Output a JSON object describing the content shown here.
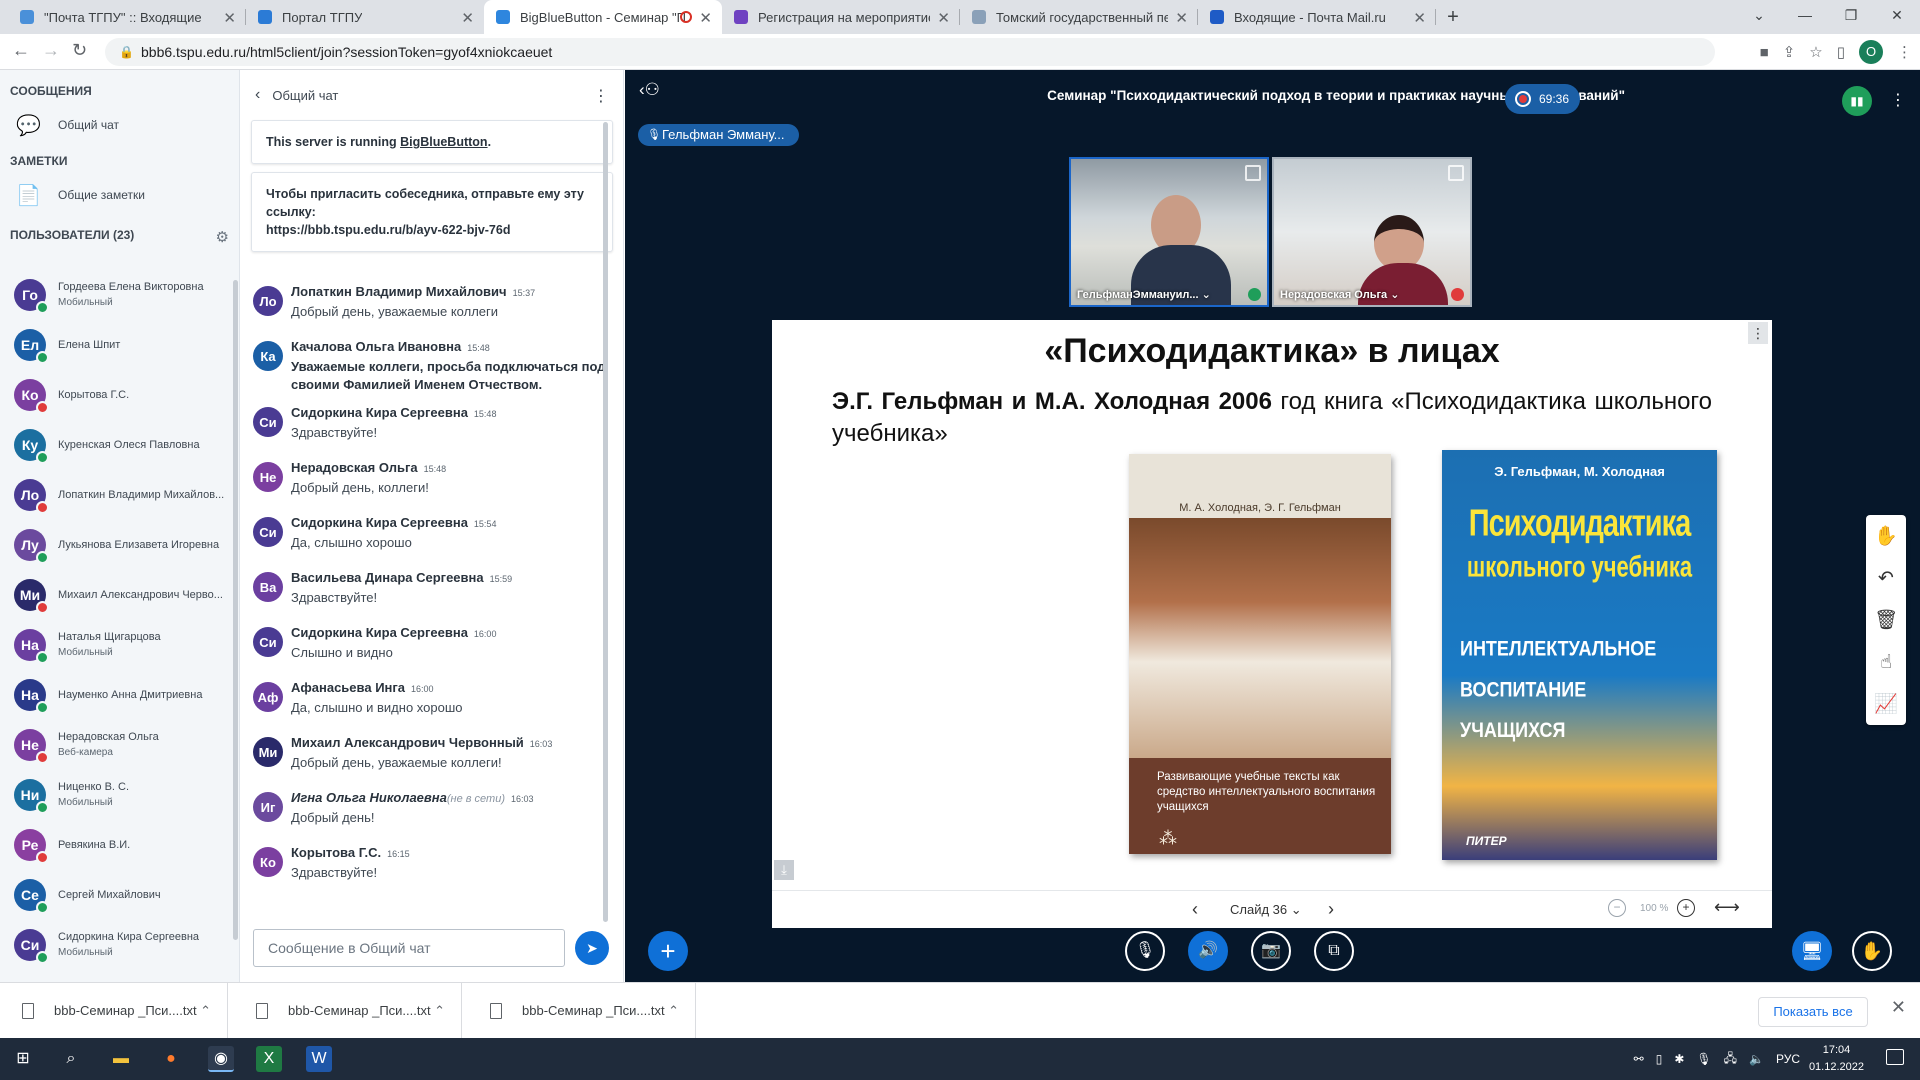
{
  "browser": {
    "tabs": [
      {
        "label": "\"Почта ТГПУ\" :: Входящие",
        "color": "#4a90d9"
      },
      {
        "label": "Портал ТГПУ",
        "color": "#2b7bd6"
      },
      {
        "label": "BigBlueButton - Семинар \"П",
        "color": "#2e86de"
      },
      {
        "label": "Регистрация на мероприятие -",
        "color": "#6f42c1"
      },
      {
        "label": "Томский государственный педа",
        "color": "#8aa0b8"
      },
      {
        "label": "Входящие - Почта Mail.ru",
        "color": "#1e5bc6"
      }
    ],
    "url": "bbb6.tspu.edu.ru/html5client/join?sessionToken=gyof4xniokcaeuet",
    "profile_letter": "O"
  },
  "sidebar": {
    "messages_head": "СООБЩЕНИЯ",
    "public_chat": "Общий чат",
    "notes_head": "ЗАМЕТКИ",
    "shared_notes": "Общие заметки",
    "users_head": "ПОЛЬЗОВАТЕЛИ (23)",
    "users": [
      {
        "initials": "Го",
        "name": "Гордеева Елена Викторовна",
        "sub": "Мобильный",
        "color": "#4a3b93",
        "status": "#1f9e5a"
      },
      {
        "initials": "Ел",
        "name": "Елена Шпит",
        "sub": "",
        "color": "#1b5fa6",
        "status": "#1f9e5a"
      },
      {
        "initials": "Ко",
        "name": "Корытова Г.С.",
        "sub": "",
        "color": "#7b3fa0",
        "status": "#e03b3b"
      },
      {
        "initials": "Ку",
        "name": "Куренская Олеся Павловна",
        "sub": "",
        "color": "#1b6fa0",
        "status": "#1f9e5a"
      },
      {
        "initials": "Ло",
        "name": "Лопаткин Владимир Михайлов...",
        "sub": "",
        "color": "#4a3b93",
        "status": "#e03b3b"
      },
      {
        "initials": "Лу",
        "name": "Лукьянова Елизавета Игоревна",
        "sub": "",
        "color": "#6b4a9e",
        "status": "#1f9e5a"
      },
      {
        "initials": "Ми",
        "name": "Михаил Александрович Черво...",
        "sub": "",
        "color": "#2a2a6a",
        "status": "#e03b3b"
      },
      {
        "initials": "На",
        "name": "Наталья Щигарцова",
        "sub": "Мобильный",
        "color": "#6b3fa0",
        "status": "#1f9e5a"
      },
      {
        "initials": "На",
        "name": "Науменко Анна Дмитриевна",
        "sub": "",
        "color": "#2a3a8a",
        "status": "#1f9e5a"
      },
      {
        "initials": "Не",
        "name": "Нерадовская Ольга",
        "sub": "Веб-камера",
        "color": "#7b3fa0",
        "status": "#e03b3b"
      },
      {
        "initials": "Ни",
        "name": "Ниценко В. С.",
        "sub": "Мобильный",
        "color": "#1b6fa0",
        "status": "#1f9e5a"
      },
      {
        "initials": "Ре",
        "name": "Ревякина В.И.",
        "sub": "",
        "color": "#8a3fa0",
        "status": "#e03b3b"
      },
      {
        "initials": "Се",
        "name": "Сергей Михайлович",
        "sub": "",
        "color": "#1b5fa6",
        "status": "#1f9e5a"
      },
      {
        "initials": "Си",
        "name": "Сидоркина Кира Сергеевна",
        "sub": "Мобильный",
        "color": "#4a3b93",
        "status": "#1f9e5a"
      }
    ]
  },
  "chat": {
    "title": "Общий чат",
    "server_notice_prefix": "This server is running",
    "server_notice_link": "BigBlueButton",
    "invite_text": "Чтобы пригласить собеседника, отправьте ему эту ссылку:",
    "invite_link": "https://bbb.tspu.edu.ru/b/ayv-622-bjv-76d",
    "messages": [
      {
        "initials": "Ло",
        "color": "#4a3b93",
        "name": "Лопаткин Владимир Михайлович",
        "time": "15:37",
        "text": "Добрый день, уважаемые коллеги",
        "bold": false,
        "offline": ""
      },
      {
        "initials": "Ка",
        "color": "#1b5fa6",
        "name": "Качалова Ольга Ивановна",
        "time": "15:48",
        "text": "Уважаемые коллеги, просьба подключаться под своими Фамилией Именем Отчеством.",
        "bold": true,
        "offline": ""
      },
      {
        "initials": "Си",
        "color": "#4a3b93",
        "name": "Сидоркина Кира Сергеевна",
        "time": "15:48",
        "text": "Здравствуйте!",
        "bold": false,
        "offline": ""
      },
      {
        "initials": "Не",
        "color": "#7b3fa0",
        "name": "Нерадовская Ольга",
        "time": "15:48",
        "text": "Добрый день, коллеги!",
        "bold": false,
        "offline": ""
      },
      {
        "initials": "Си",
        "color": "#4a3b93",
        "name": "Сидоркина Кира Сергеевна",
        "time": "15:54",
        "text": "Да, слышно хорошо",
        "bold": false,
        "offline": ""
      },
      {
        "initials": "Ва",
        "color": "#6b3fa0",
        "name": "Васильева Динара Сергеевна",
        "time": "15:59",
        "text": "Здравствуйте!",
        "bold": false,
        "offline": ""
      },
      {
        "initials": "Си",
        "color": "#4a3b93",
        "name": "Сидоркина Кира Сергеевна",
        "time": "16:00",
        "text": "Слышно и видно",
        "bold": false,
        "offline": ""
      },
      {
        "initials": "Аф",
        "color": "#6b3fa0",
        "name": "Афанасьева Инга",
        "time": "16:00",
        "text": "Да, слышно и видно хорошо",
        "bold": false,
        "offline": ""
      },
      {
        "initials": "Ми",
        "color": "#2a2a6a",
        "name": "Михаил Александрович Червонный",
        "time": "16:03",
        "text": "Добрый день, уважаемые коллеги!",
        "bold": false,
        "offline": ""
      },
      {
        "initials": "Иг",
        "color": "#6b4a9e",
        "name": "Игна Ольга Николаевна",
        "time": "16:03",
        "text": "Добрый день!",
        "bold": false,
        "offline": "(не в сети)"
      },
      {
        "initials": "Ко",
        "color": "#7b3fa0",
        "name": "Корытова Г.С.",
        "time": "16:15",
        "text": "Здравствуйте!",
        "bold": false,
        "offline": ""
      }
    ],
    "input_placeholder": "Сообщение в Общий чат"
  },
  "stage": {
    "meeting_title": "Семинар \"Психодидактический подход в теории и практиках научных исследований\"",
    "rec_time": "69:36",
    "talker": "Гельфман Эмману...",
    "videos": [
      {
        "label": "ГельфманЭммануил... ⌄"
      },
      {
        "label": "Нерадовская Ольга ⌄"
      }
    ],
    "slide": {
      "title": "«Психодидактика» в лицах",
      "text_bold": "Э.Г. Гельфман и М.А. Холодная 2006",
      "text_rest": " год книга «Психодидактика школьного учебника»",
      "book1_authors": "М. А. Холодная, Э. Г. Гельфман",
      "book1_subtitle": "Развивающие учебные тексты как средство интеллектуального воспитания учащихся",
      "book2_authors": "Э. Гельфман, М. Холодная",
      "book2_title1": "Психодидактика",
      "book2_title2": "школьного учебника",
      "book2_sub": "ИНТЕЛЛЕКТУАЛЬНОЕ ВОСПИТАНИЕ УЧАЩИХСЯ",
      "book2_publisher": "ПИТЕР"
    },
    "slide_label": "Слайд 36",
    "zoom": "100 %"
  },
  "downloads": {
    "items": [
      "bbb-Семинар _Пси....txt",
      "bbb-Семинар _Пси....txt",
      "bbb-Семинар _Пси....txt"
    ],
    "show_all": "Показать все"
  },
  "taskbar": {
    "lang": "РУС",
    "time": "17:04",
    "date": "01.12.2022"
  }
}
